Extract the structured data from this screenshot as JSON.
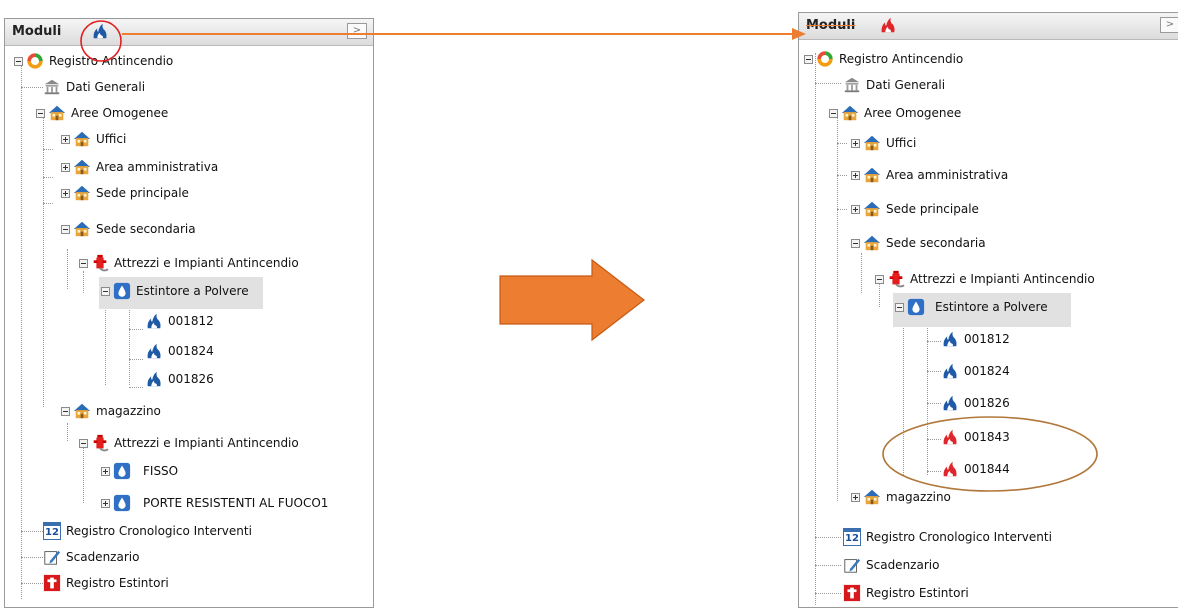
{
  "colors": {
    "accent_orange": "#ed7d31",
    "circle_red": "#e02020",
    "oval_brown": "#b0773a",
    "selection": "#e1e1e1"
  },
  "left_panel": {
    "header": {
      "title": "Moduli",
      "icon": "flame-blue-icon",
      "collapse_glyph": ">"
    },
    "tree": {
      "root": "Registro Antincendio",
      "dati_generali": "Dati Generali",
      "aree_omogenee": "Aree Omogenee",
      "uffici": "Uffici",
      "area_amministrativa": "Area amministrativa",
      "sede_principale": "Sede principale",
      "sede_secondaria": "Sede secondaria",
      "attrezzi": "Attrezzi e Impianti Antincendio",
      "estintore": "Estintore a Polvere",
      "items": [
        "001812",
        "001824",
        "001826"
      ],
      "magazzino": "magazzino",
      "attrezzi_mag": "Attrezzi e Impianti Antincendio",
      "fisso": "FISSO",
      "porte": "PORTE RESISTENTI AL FUOCO1",
      "registro_cronologico": "Registro Cronologico Interventi",
      "scadenzario": "Scadenzario",
      "registro_estintori": "Registro Estintori"
    }
  },
  "right_panel": {
    "header": {
      "title": "Moduli",
      "icon": "flame-red-icon",
      "collapse_glyph": ">"
    },
    "tree": {
      "root": "Registro Antincendio",
      "dati_generali": "Dati Generali",
      "aree_omogenee": "Aree Omogenee",
      "uffici": "Uffici",
      "area_amministrativa": "Area amministrativa",
      "sede_principale": "Sede principale",
      "sede_secondaria": "Sede secondaria",
      "attrezzi": "Attrezzi e Impianti Antincendio",
      "estintore": "Estintore a Polvere",
      "items": [
        "001812",
        "001824",
        "001826"
      ],
      "new_items": [
        "001843",
        "001844"
      ],
      "magazzino": "magazzino",
      "registro_cronologico": "Registro Cronologico Interventi",
      "scadenzario": "Scadenzario",
      "registro_estintori": "Registro Estintori"
    }
  },
  "calendar_icon_text": "12"
}
